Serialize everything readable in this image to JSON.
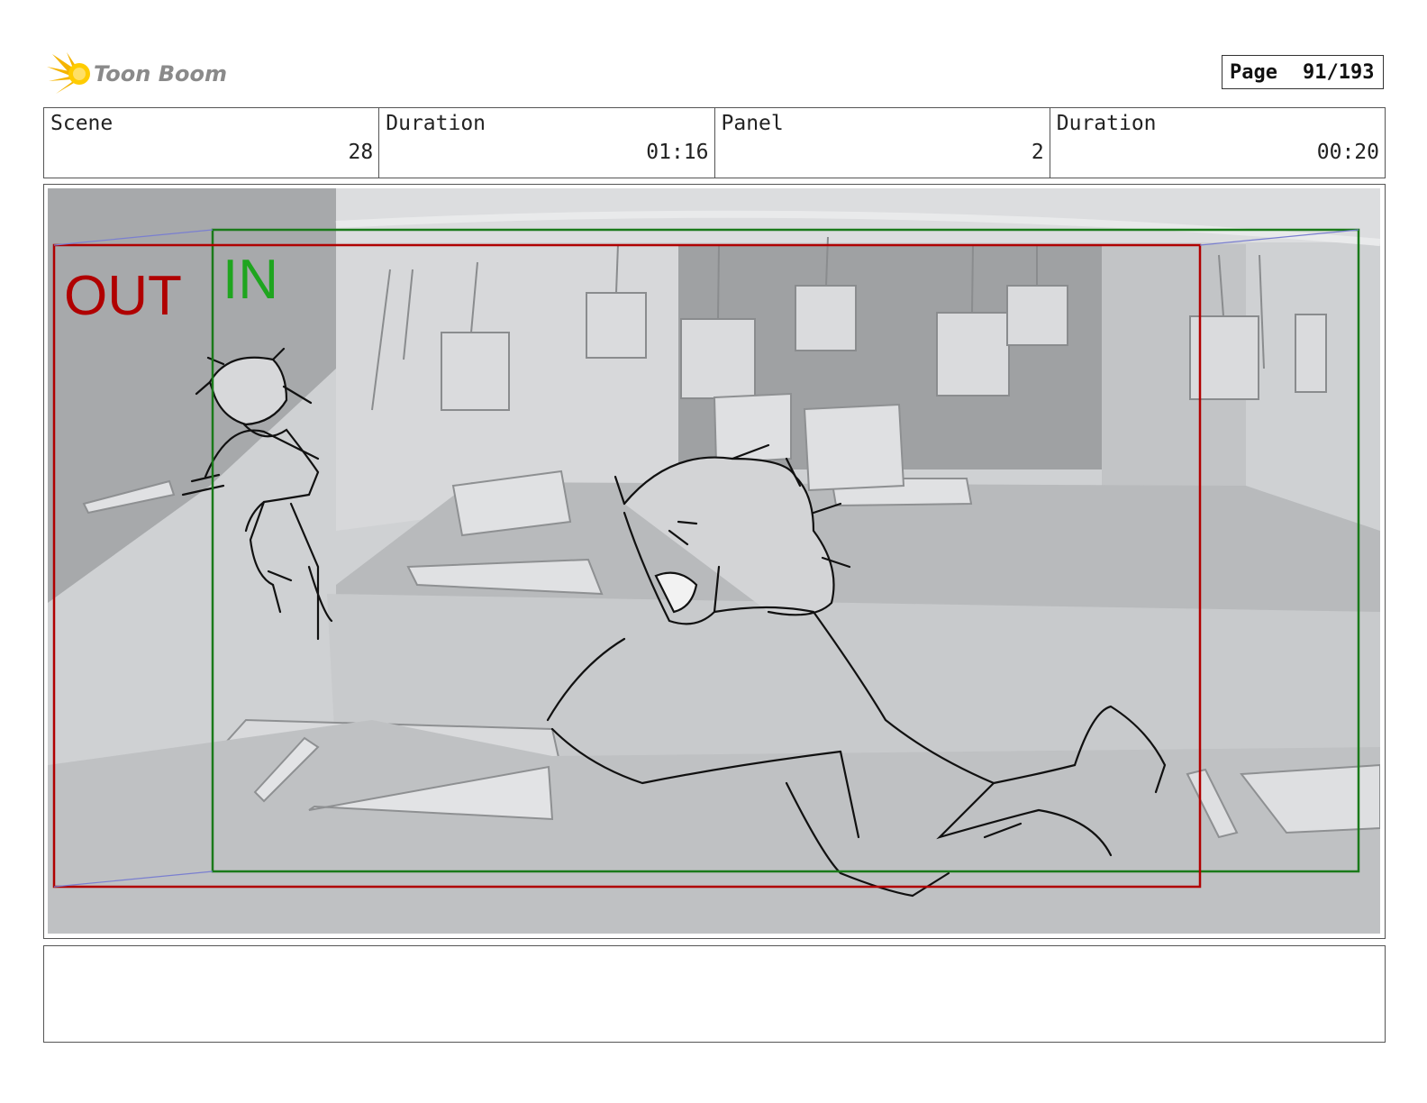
{
  "header": {
    "logo_text": "Toon Boom",
    "page_label": "Page",
    "page_value": "91/193"
  },
  "info": {
    "scene_label": "Scene",
    "scene_value": "28",
    "duration_label": "Duration",
    "duration_value": "01:16",
    "panel_label": "Panel",
    "panel_value": "2",
    "panel_duration_label": "Duration",
    "panel_duration_value": "00:20"
  },
  "panel": {
    "out_label": "OUT",
    "in_label": "IN",
    "out_color": "#b00000",
    "in_color": "#1a8f1a"
  },
  "notes": {
    "text": ""
  }
}
